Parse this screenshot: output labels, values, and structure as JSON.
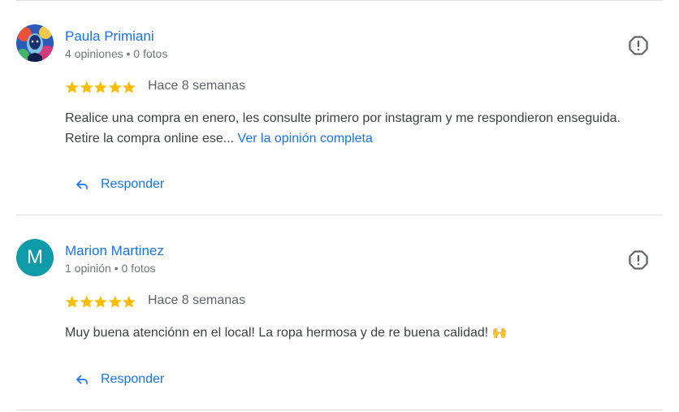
{
  "reviews": [
    {
      "author": "Paula Primiani",
      "meta": "4 opiniones • 0 fotos",
      "rating": 5,
      "date": "Hace 8 semanas",
      "text": "Realice una compra en enero, les consulte primero por instagram y me respondieron enseguida. Retire la compra online ese... ",
      "more_label": "Ver la opinión completa",
      "reply_label": "Responder",
      "avatar_icon": "painted-portrait-avatar"
    },
    {
      "author": "Marion Martinez",
      "avatar_letter": "M",
      "meta": "1 opinión • 0 fotos",
      "rating": 5,
      "date": "Hace 8 semanas",
      "text": "Muy buena atenciónn en el local! La ropa hermosa y de re buena calidad! ",
      "emoji": "🙌",
      "reply_label": "Responder"
    }
  ],
  "colors": {
    "link": "#1a73e8",
    "star": "#fbbc04",
    "avatar_bg": "#0e9aa7",
    "divider": "#dadce0"
  },
  "icons": {
    "flag": "report-flag-icon",
    "reply": "reply-arrow-icon",
    "star": "star-icon"
  }
}
